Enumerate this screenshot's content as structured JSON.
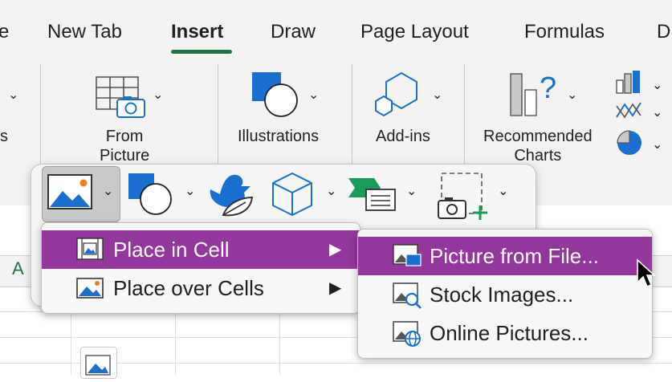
{
  "tabs": [
    {
      "label": "e"
    },
    {
      "label": "New Tab"
    },
    {
      "label": "Insert",
      "active": true
    },
    {
      "label": "Draw"
    },
    {
      "label": "Page Layout"
    },
    {
      "label": "Formulas"
    },
    {
      "label": "D"
    }
  ],
  "ribbon": {
    "left_fragment": "s",
    "from_picture": "From\nPicture",
    "illustrations": "Illustrations",
    "addins": "Add-ins",
    "recommended_charts": "Recommended\nCharts"
  },
  "sheet": {
    "column_a": "A"
  },
  "flyout_icons": [
    "picture-icon",
    "shapes-icon",
    "icons-icon",
    "3d-models-icon",
    "smartart-icon",
    "screenshot-icon"
  ],
  "picture_menu": {
    "items": [
      {
        "label": "Place in Cell",
        "selected": true,
        "has_submenu": true
      },
      {
        "label": "Place over Cells",
        "selected": false,
        "has_submenu": true
      }
    ]
  },
  "submenu": {
    "items": [
      {
        "label": "Picture from File...",
        "selected": true
      },
      {
        "label": "Stock Images...",
        "selected": false
      },
      {
        "label": "Online Pictures...",
        "selected": false
      }
    ]
  },
  "colors": {
    "accent_green": "#217346",
    "menu_highlight": "#93379c",
    "icon_blue": "#1b6fd1"
  }
}
